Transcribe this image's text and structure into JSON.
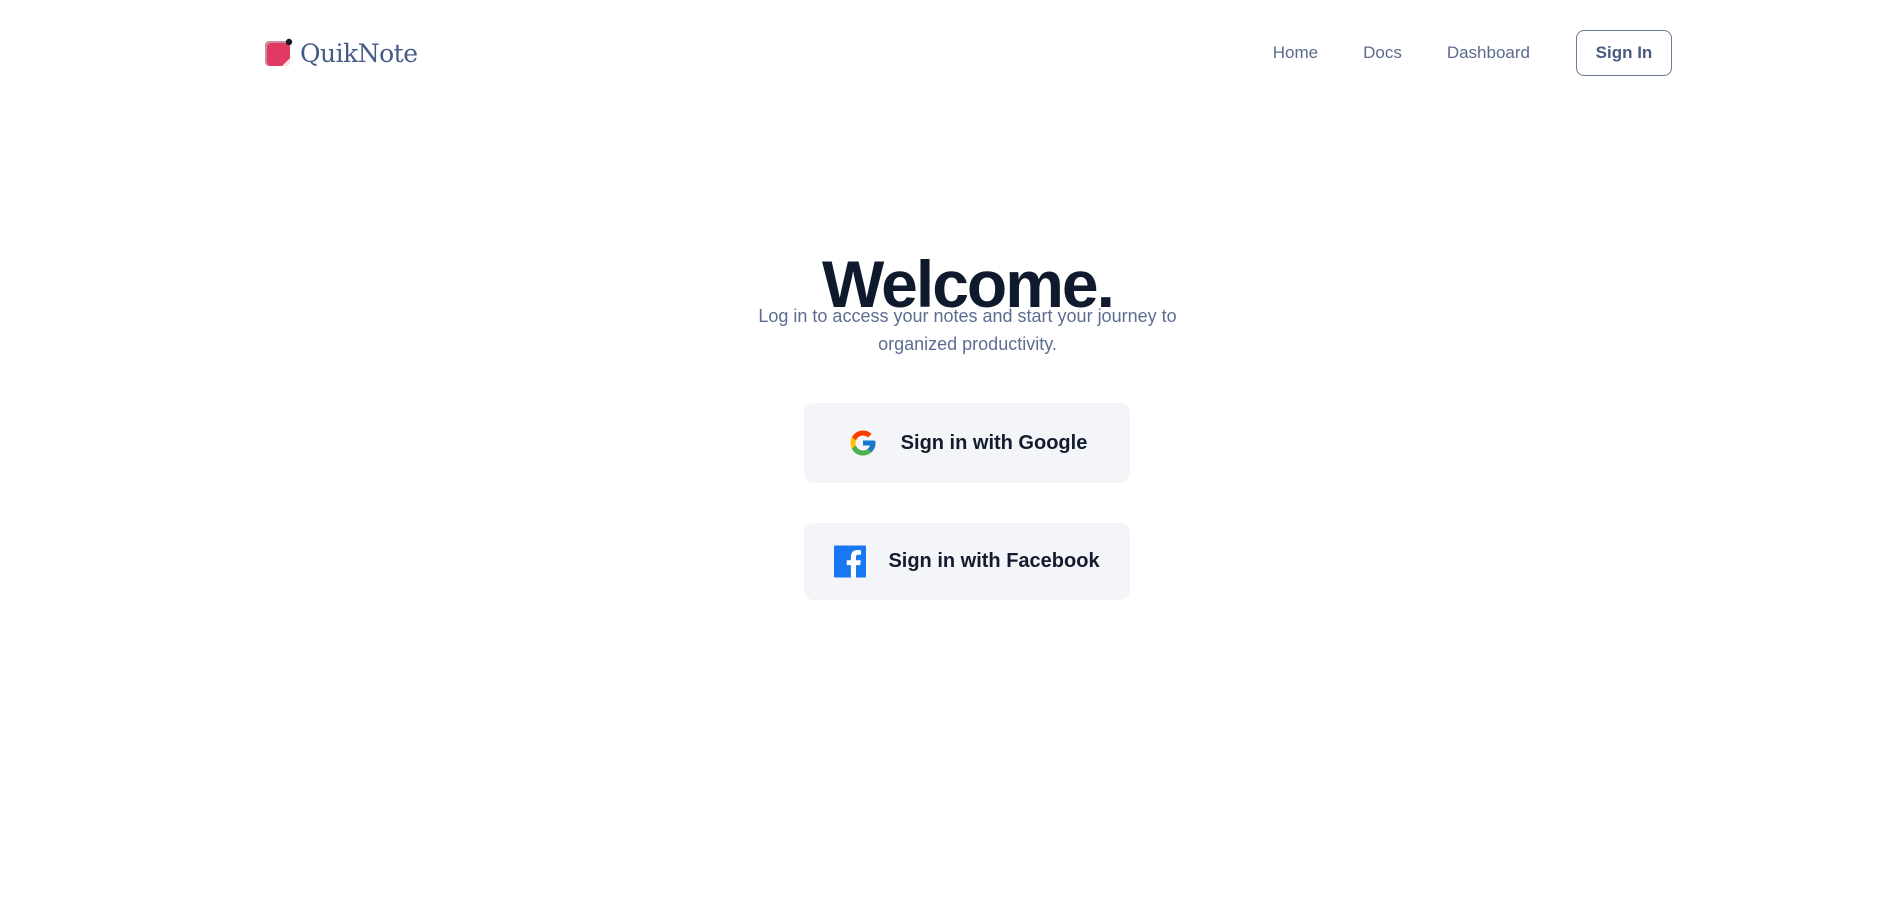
{
  "brand": {
    "name": "QuikNote",
    "logo_icon": "sticky-note-logo",
    "accent_color": "#e03a62"
  },
  "nav": {
    "links": [
      {
        "label": "Home"
      },
      {
        "label": "Docs"
      },
      {
        "label": "Dashboard"
      }
    ],
    "signin_label": "Sign In"
  },
  "hero": {
    "title": "Welcome.",
    "subtitle_line1": "Log in to access your notes and start your journey to",
    "subtitle_line2": "organized productivity."
  },
  "auth": {
    "google_label": "Sign in with Google",
    "google_icon": "google-icon",
    "facebook_label": "Sign in with Facebook",
    "facebook_icon": "facebook-icon",
    "facebook_color": "#1877f2"
  }
}
